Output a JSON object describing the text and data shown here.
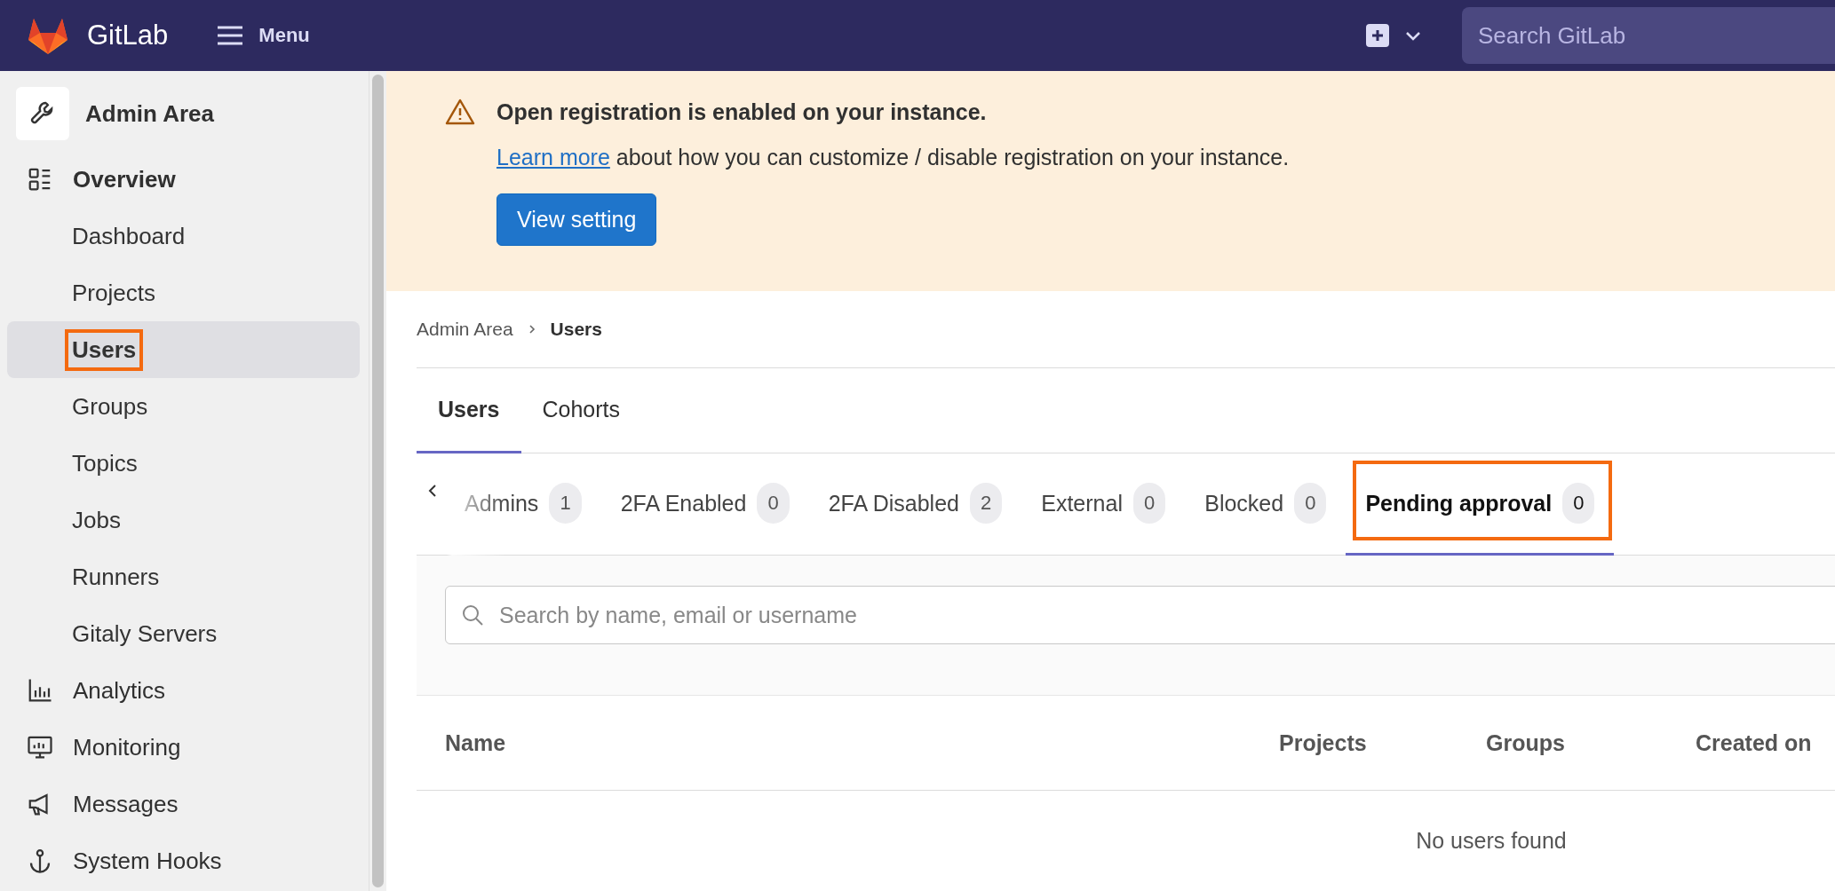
{
  "top_bar": {
    "brand": "GitLab",
    "menu": "Menu",
    "search": {
      "placeholder": "Search GitLab"
    }
  },
  "sidebar": {
    "title": "Admin Area",
    "items": [
      {
        "label": "Overview",
        "expanded": true,
        "children": [
          {
            "label": "Dashboard",
            "selected": false,
            "highlighted": false
          },
          {
            "label": "Projects",
            "selected": false,
            "highlighted": false
          },
          {
            "label": "Users",
            "selected": true,
            "highlighted": true
          },
          {
            "label": "Groups",
            "selected": false,
            "highlighted": false
          },
          {
            "label": "Topics",
            "selected": false,
            "highlighted": false
          },
          {
            "label": "Jobs",
            "selected": false,
            "highlighted": false
          },
          {
            "label": "Runners",
            "selected": false,
            "highlighted": false
          },
          {
            "label": "Gitaly Servers",
            "selected": false,
            "highlighted": false
          }
        ]
      },
      {
        "label": "Analytics",
        "expanded": false
      },
      {
        "label": "Monitoring",
        "expanded": false
      },
      {
        "label": "Messages",
        "expanded": false
      },
      {
        "label": "System Hooks",
        "expanded": false
      }
    ]
  },
  "banner": {
    "title": "Open registration is enabled on your instance.",
    "link": "Learn more",
    "text": "about how you can customize / disable registration on your instance.",
    "button": "View setting"
  },
  "breadcrumb": [
    "Admin Area",
    "Users"
  ],
  "tabs": [
    {
      "label": "Users",
      "selected": true
    },
    {
      "label": "Cohorts",
      "selected": false
    }
  ],
  "filter_tabs": [
    {
      "label": "Admins",
      "count": "1",
      "selected": false,
      "highlighted": false
    },
    {
      "label": "2FA Enabled",
      "count": "0",
      "selected": false,
      "highlighted": false
    },
    {
      "label": "2FA Disabled",
      "count": "2",
      "selected": false,
      "highlighted": false
    },
    {
      "label": "External",
      "count": "0",
      "selected": false,
      "highlighted": false
    },
    {
      "label": "Blocked",
      "count": "0",
      "selected": false,
      "highlighted": false
    },
    {
      "label": "Pending approval",
      "count": "0",
      "selected": true,
      "highlighted": true
    }
  ],
  "search": {
    "placeholder": "Search by name, email or username"
  },
  "table": {
    "columns": [
      "Name",
      "Projects",
      "Groups",
      "Created on"
    ],
    "empty": "No users found"
  }
}
